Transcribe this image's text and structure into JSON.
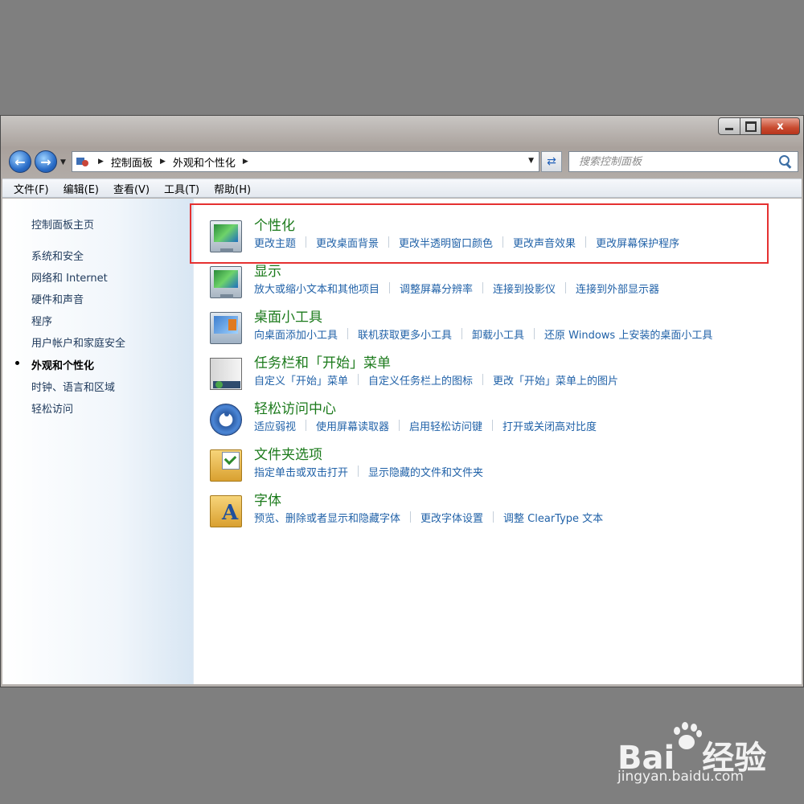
{
  "window": {
    "controls": {
      "close": "x"
    },
    "breadcrumb": [
      "控制面板",
      "外观和个性化"
    ],
    "search": {
      "placeholder": "搜索控制面板"
    }
  },
  "menubar": [
    "文件(F)",
    "编辑(E)",
    "查看(V)",
    "工具(T)",
    "帮助(H)"
  ],
  "sidebar": {
    "home": "控制面板主页",
    "items": [
      {
        "label": "系统和安全",
        "current": false
      },
      {
        "label": "网络和 Internet",
        "current": false
      },
      {
        "label": "硬件和声音",
        "current": false
      },
      {
        "label": "程序",
        "current": false
      },
      {
        "label": "用户帐户和家庭安全",
        "current": false
      },
      {
        "label": "外观和个性化",
        "current": true
      },
      {
        "label": "时钟、语言和区域",
        "current": false
      },
      {
        "label": "轻松访问",
        "current": false
      }
    ]
  },
  "categories": [
    {
      "title": "个性化",
      "icon": "personalization-icon",
      "highlighted": true,
      "links": [
        "更改主题",
        "更改桌面背景",
        "更改半透明窗口颜色",
        "更改声音效果",
        "更改屏幕保护程序"
      ]
    },
    {
      "title": "显示",
      "icon": "display-icon",
      "links": [
        "放大或缩小文本和其他项目",
        "调整屏幕分辨率",
        "连接到投影仪",
        "连接到外部显示器"
      ]
    },
    {
      "title": "桌面小工具",
      "icon": "gadgets-icon",
      "links": [
        "向桌面添加小工具",
        "联机获取更多小工具",
        "卸载小工具",
        "还原 Windows 上安装的桌面小工具"
      ]
    },
    {
      "title": "任务栏和「开始」菜单",
      "icon": "taskbar-icon",
      "links": [
        "自定义「开始」菜单",
        "自定义任务栏上的图标",
        "更改「开始」菜单上的图片"
      ]
    },
    {
      "title": "轻松访问中心",
      "icon": "ease-of-access-icon",
      "links": [
        "适应弱视",
        "使用屏幕读取器",
        "启用轻松访问键",
        "打开或关闭高对比度"
      ]
    },
    {
      "title": "文件夹选项",
      "icon": "folder-options-icon",
      "links": [
        "指定单击或双击打开",
        "显示隐藏的文件和文件夹"
      ]
    },
    {
      "title": "字体",
      "icon": "fonts-icon",
      "links": [
        "预览、删除或者显示和隐藏字体",
        "更改字体设置",
        "调整 ClearType 文本"
      ]
    }
  ],
  "watermark": {
    "logo": "Bai",
    "logo_cn": "经验",
    "url": "jingyan.baidu.com"
  },
  "colors": {
    "highlight": "#e53131",
    "category_title": "#1b7a1b",
    "link": "#2162a8"
  }
}
